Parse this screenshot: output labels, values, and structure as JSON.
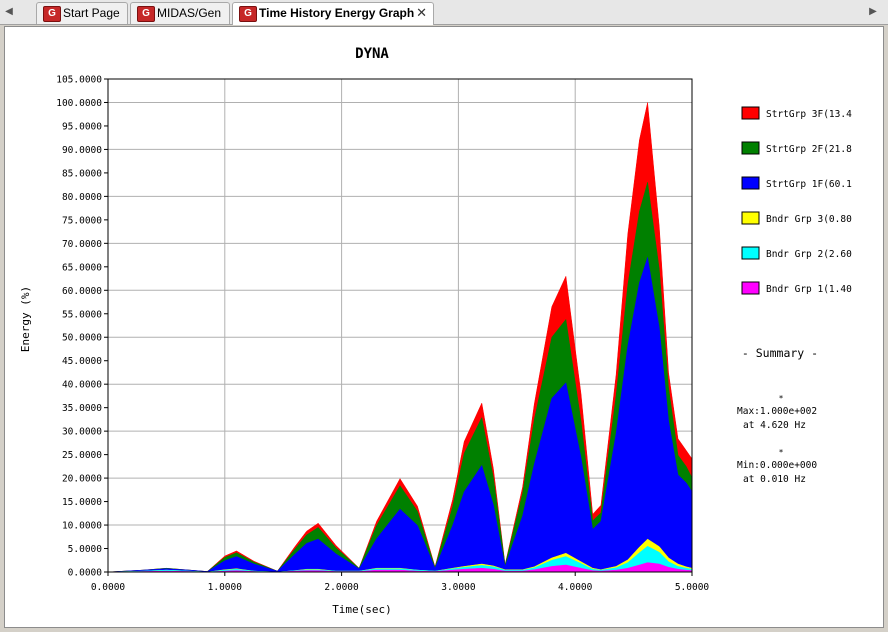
{
  "tabs": [
    {
      "label": "Start Page",
      "active": false
    },
    {
      "label": "MIDAS/Gen",
      "active": false
    },
    {
      "label": "Time History Energy Graph",
      "active": true
    }
  ],
  "tab_close_glyph": "✕",
  "tab_icon_glyph": "G",
  "nav_prev_glyph": "◀",
  "nav_next_glyph": "▶",
  "chart_data": {
    "type": "area",
    "stacked": true,
    "title": "DYNA",
    "xlabel": "Time(sec)",
    "ylabel": "Energy (%)",
    "xlim": [
      0,
      5
    ],
    "ylim": [
      0,
      105
    ],
    "xticks": [
      "0.0000",
      "1.0000",
      "2.0000",
      "3.0000",
      "4.0000",
      "5.0000"
    ],
    "yticks": [
      "0.0000",
      "5.0000",
      "10.0000",
      "15.0000",
      "20.0000",
      "25.0000",
      "30.0000",
      "35.0000",
      "40.0000",
      "45.0000",
      "50.0000",
      "55.0000",
      "60.0000",
      "65.0000",
      "70.0000",
      "75.0000",
      "80.0000",
      "85.0000",
      "90.0000",
      "95.0000",
      "100.0000",
      "105.0000"
    ],
    "grid": true,
    "legend_position": "right",
    "x": [
      0.0,
      0.3,
      0.5,
      0.7,
      0.85,
      1.0,
      1.1,
      1.25,
      1.45,
      1.6,
      1.7,
      1.8,
      1.95,
      2.15,
      2.3,
      2.5,
      2.65,
      2.8,
      2.95,
      3.05,
      3.2,
      3.3,
      3.4,
      3.55,
      3.65,
      3.8,
      3.92,
      4.05,
      4.15,
      4.22,
      4.35,
      4.45,
      4.55,
      4.62,
      4.72,
      4.8,
      4.88,
      4.95,
      5.0
    ],
    "series": [
      {
        "name": "Bndr Grp 1(1.40",
        "color": "#ff00ff",
        "values": [
          0.0,
          0.1,
          0.2,
          0.1,
          0.0,
          0.2,
          0.3,
          0.1,
          0.0,
          0.2,
          0.3,
          0.3,
          0.1,
          0.1,
          0.4,
          0.4,
          0.2,
          0.1,
          0.4,
          0.6,
          0.8,
          0.6,
          0.2,
          0.2,
          0.5,
          1.2,
          1.5,
          0.8,
          0.3,
          0.2,
          0.4,
          0.8,
          1.5,
          2.0,
          1.7,
          1.0,
          0.6,
          0.4,
          0.3
        ]
      },
      {
        "name": "Bndr Grp 2(2.60",
        "color": "#00ffff",
        "values": [
          0.0,
          0.1,
          0.2,
          0.1,
          0.0,
          0.2,
          0.3,
          0.1,
          0.0,
          0.1,
          0.2,
          0.2,
          0.1,
          0.1,
          0.3,
          0.3,
          0.2,
          0.1,
          0.3,
          0.4,
          0.6,
          0.5,
          0.2,
          0.2,
          0.4,
          1.3,
          1.8,
          1.0,
          0.3,
          0.2,
          0.5,
          1.2,
          2.6,
          3.5,
          2.5,
          1.2,
          0.6,
          0.4,
          0.3
        ]
      },
      {
        "name": "Bndr Grp 3(0.80",
        "color": "#ffff00",
        "values": [
          0.0,
          0.0,
          0.0,
          0.0,
          0.0,
          0.1,
          0.1,
          0.0,
          0.0,
          0.0,
          0.1,
          0.1,
          0.0,
          0.0,
          0.1,
          0.1,
          0.0,
          0.0,
          0.1,
          0.2,
          0.3,
          0.2,
          0.1,
          0.1,
          0.2,
          0.5,
          0.7,
          0.4,
          0.2,
          0.1,
          0.3,
          0.6,
          1.2,
          1.5,
          1.2,
          0.8,
          0.5,
          0.3,
          0.2
        ]
      },
      {
        "name": "StrtGrp 1F(60.1",
        "color": "#0000ff",
        "values": [
          0.0,
          0.2,
          0.3,
          0.2,
          0.1,
          1.9,
          2.6,
          1.5,
          0.2,
          3.5,
          5.5,
          6.4,
          3.7,
          0.5,
          6.3,
          12.6,
          9.5,
          0.6,
          9.1,
          15.9,
          21.0,
          13.0,
          0.7,
          11.5,
          21.9,
          34.0,
          36.3,
          22.2,
          8.3,
          10.3,
          28.3,
          45.6,
          56.3,
          60.0,
          46.6,
          29.2,
          19.0,
          17.9,
          16.3
        ]
      },
      {
        "name": "StrtGrp 2F(21.8",
        "color": "#008000",
        "values": [
          0.0,
          0.0,
          0.1,
          0.0,
          0.0,
          0.7,
          0.8,
          0.4,
          0.0,
          1.1,
          1.8,
          2.5,
          1.3,
          0.1,
          2.8,
          5.0,
          3.0,
          0.2,
          4.0,
          8.2,
          10.2,
          5.8,
          0.3,
          4.8,
          9.5,
          13.0,
          13.5,
          7.8,
          1.8,
          1.8,
          8.1,
          13.0,
          15.2,
          16.0,
          12.5,
          7.0,
          4.2,
          3.5,
          3.0
        ]
      },
      {
        "name": "StrtGrp 3F(13.4",
        "color": "#ff0000",
        "values": [
          0.0,
          0.0,
          0.0,
          0.0,
          0.0,
          0.3,
          0.4,
          0.2,
          0.0,
          0.5,
          0.8,
          0.9,
          0.5,
          0.0,
          0.9,
          1.5,
          1.1,
          0.1,
          1.5,
          2.5,
          3.1,
          1.9,
          0.1,
          1.3,
          3.3,
          6.5,
          9.2,
          5.8,
          1.4,
          1.6,
          4.4,
          10.8,
          15.2,
          17.0,
          9.0,
          3.2,
          3.5,
          3.4,
          4.0
        ]
      }
    ],
    "legend_order": [
      "StrtGrp 3F(13.4",
      "StrtGrp 2F(21.8",
      "StrtGrp 1F(60.1",
      "Bndr Grp 3(0.80",
      "Bndr Grp 2(2.60",
      "Bndr Grp 1(1.40"
    ],
    "summary": {
      "title": "- Summary -",
      "marker": "*",
      "max_text": "Max:1.000e+002",
      "max_at": "at  4.620 Hz",
      "min_text": "Min:0.000e+000",
      "min_at": "at  0.010 Hz"
    }
  }
}
